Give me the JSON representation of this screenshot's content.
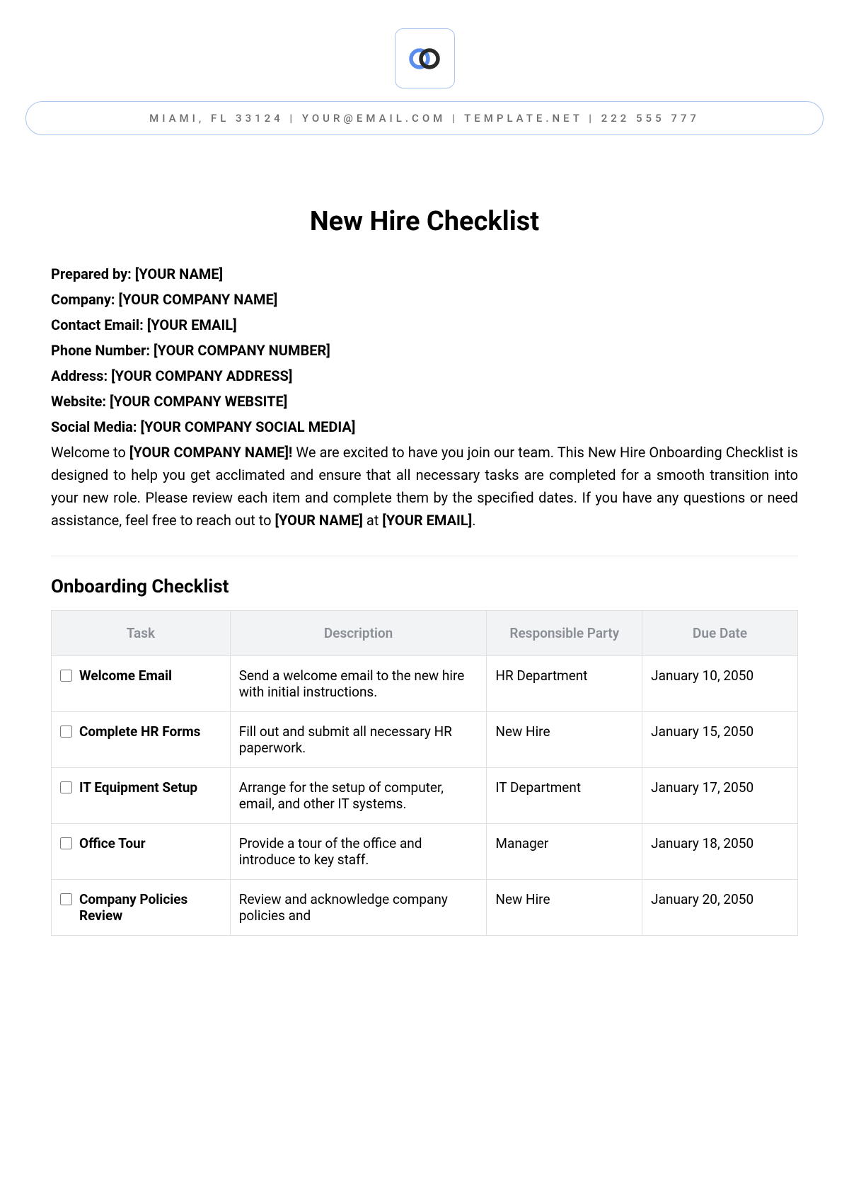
{
  "contact_bar": "MIAMI, FL 33124 | YOUR@EMAIL.COM | TEMPLATE.NET | 222 555 777",
  "title": "New Hire Checklist",
  "meta": {
    "prepared_by": {
      "label": "Prepared by: ",
      "value": "[YOUR NAME]"
    },
    "company": {
      "label": "Company: ",
      "value": "[YOUR COMPANY NAME]"
    },
    "contact_email": {
      "label": "Contact Email: ",
      "value": "[YOUR EMAIL]"
    },
    "phone": {
      "label": "Phone Number: ",
      "value": "[YOUR COMPANY NUMBER]"
    },
    "address": {
      "label": "Address: ",
      "value": "[YOUR COMPANY ADDRESS]"
    },
    "website": {
      "label": "Website: ",
      "value": "[YOUR COMPANY WEBSITE]"
    },
    "social": {
      "label": "Social Media: ",
      "value": "[YOUR COMPANY SOCIAL MEDIA]"
    }
  },
  "welcome": {
    "pre": "Welcome to ",
    "company_ph": "[YOUR COMPANY NAME]!",
    "mid": " We are excited to have you join our team. This New Hire Onboarding Checklist is designed to help you get acclimated and ensure that all necessary tasks are completed for a smooth transition into your new role. Please review each item and complete them by the specified dates. If you have any questions or need assistance, feel free to reach out to ",
    "name_ph": "[YOUR NAME]",
    "at": " at ",
    "email_ph": "[YOUR EMAIL]",
    "end": "."
  },
  "section_title": "Onboarding Checklist",
  "table": {
    "headers": {
      "task": "Task",
      "description": "Description",
      "responsible": "Responsible Party",
      "due_date": "Due Date"
    },
    "rows": [
      {
        "task": "Welcome Email",
        "description": "Send a welcome email to the new hire with initial instructions.",
        "responsible": "HR Department",
        "due_date": "January 10, 2050"
      },
      {
        "task": "Complete HR Forms",
        "description": "Fill out and submit all necessary HR paperwork.",
        "responsible": "New Hire",
        "due_date": "January 15, 2050"
      },
      {
        "task": "IT Equipment Setup",
        "description": "Arrange for the setup of computer, email, and other IT systems.",
        "responsible": "IT Department",
        "due_date": "January 17, 2050"
      },
      {
        "task": "Office Tour",
        "description": "Provide a tour of the office and introduce to key staff.",
        "responsible": "Manager",
        "due_date": "January 18, 2050"
      },
      {
        "task": "Company Policies Review",
        "description": "Review and acknowledge company policies and",
        "responsible": "New Hire",
        "due_date": "January 20, 2050"
      }
    ]
  }
}
